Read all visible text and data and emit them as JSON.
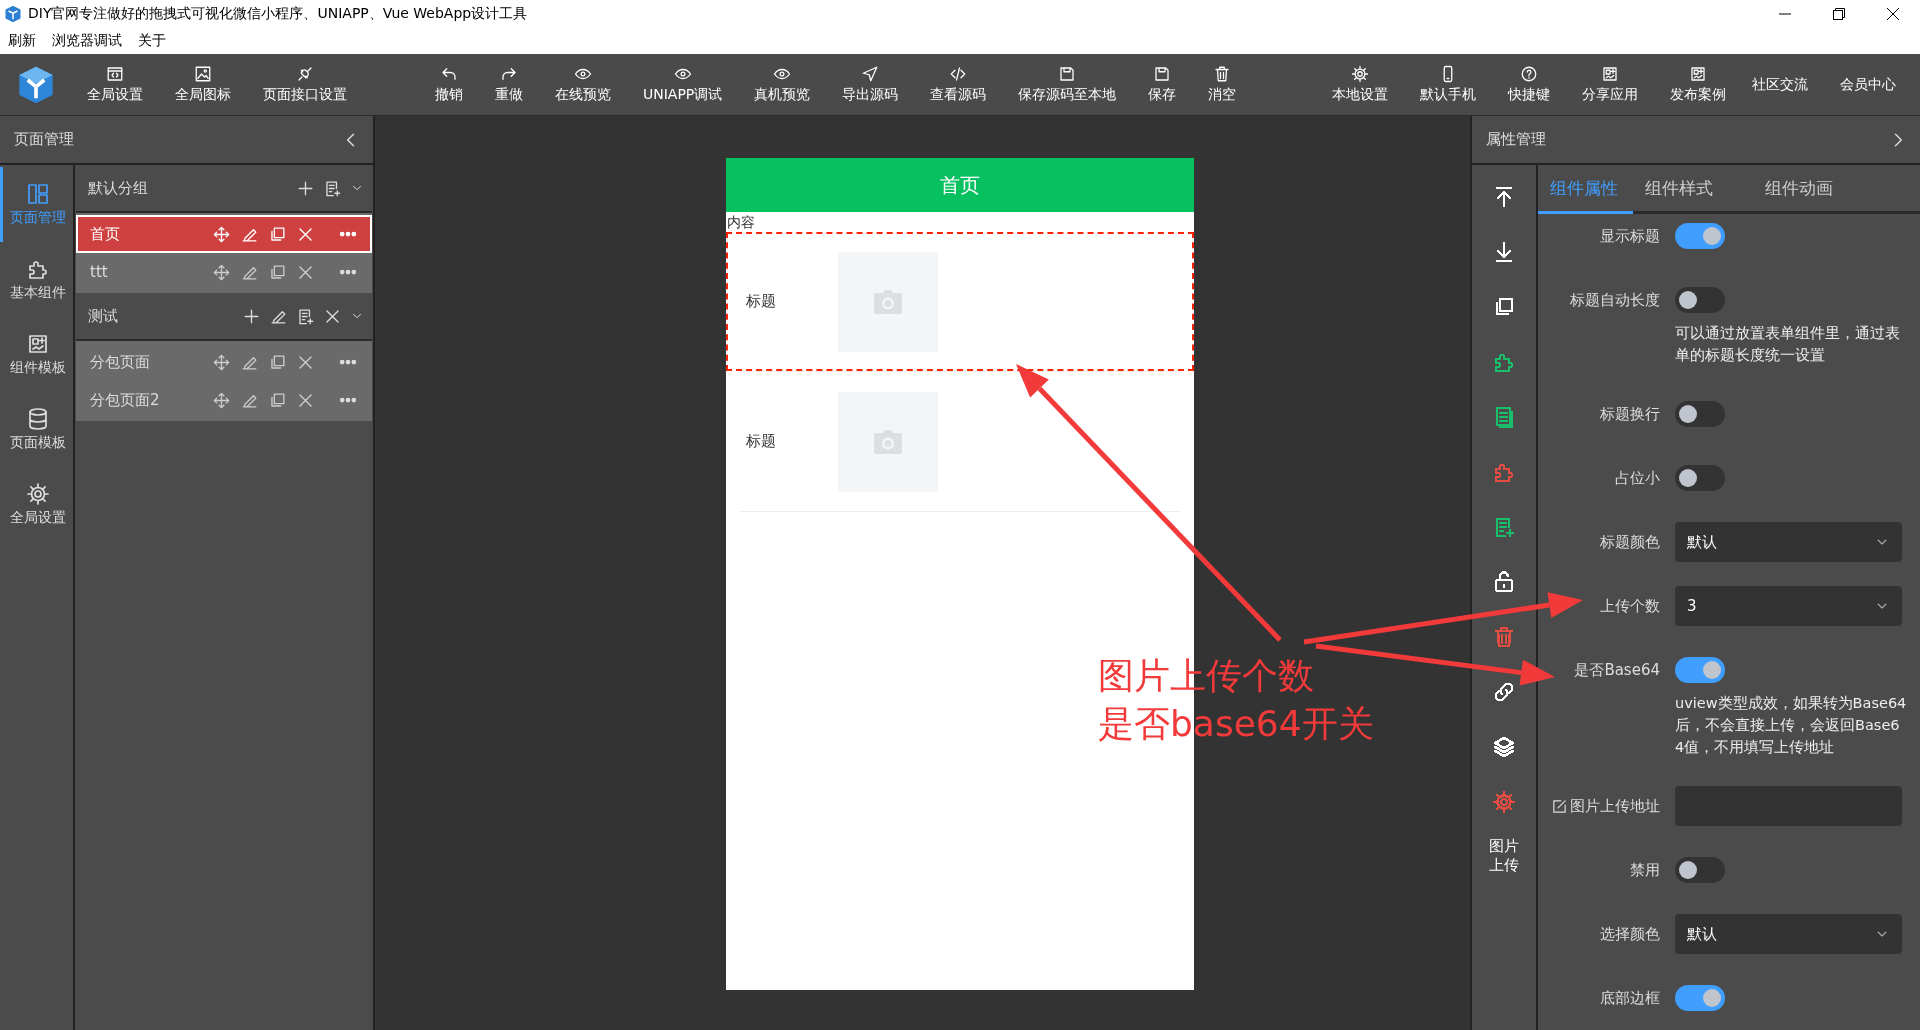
{
  "window": {
    "title": "DIY官网专注做好的拖拽式可视化微信小程序、UNIAPP、Vue WebApp设计工具"
  },
  "menu": [
    "刷新",
    "浏览器调试",
    "关于"
  ],
  "toolbar": {
    "groups": [
      {
        "items": [
          "全局设置",
          "全局图标",
          "页面接口设置"
        ]
      },
      {
        "items": [
          "撤销",
          "重做",
          "在线预览",
          "UNIAPP调试",
          "真机预览",
          "导出源码",
          "查看源码",
          "保存源码至本地",
          "保存",
          "消空"
        ]
      },
      {
        "items": [
          "本地设置",
          "默认手机",
          "快捷键",
          "分享应用",
          "发布案例"
        ]
      },
      {
        "items": [
          "社区交流",
          "会员中心"
        ]
      }
    ]
  },
  "left_panel": {
    "title": "页面管理",
    "nav": [
      {
        "label": "页面管理",
        "selected": true
      },
      {
        "label": "基本组件",
        "selected": false
      },
      {
        "label": "组件模板",
        "selected": false
      },
      {
        "label": "页面模板",
        "selected": false
      },
      {
        "label": "全局设置",
        "selected": false
      }
    ],
    "groups": [
      {
        "name": "默认分组",
        "kind": "default",
        "pages": [
          {
            "name": "首页",
            "selected": true
          },
          {
            "name": "ttt",
            "selected": false
          }
        ]
      },
      {
        "name": "测试",
        "kind": "custom",
        "pages": [
          {
            "name": "分包页面",
            "selected": false
          },
          {
            "name": "分包页面2",
            "selected": false
          }
        ]
      }
    ]
  },
  "phone": {
    "title": "首页",
    "content_label": "内容",
    "items": [
      {
        "label": "标题",
        "selected": true
      },
      {
        "label": "标题",
        "selected": false
      }
    ]
  },
  "right_panel": {
    "title": "属性管理",
    "tools": [
      {
        "color": "#ffffff"
      },
      {
        "color": "#ffffff"
      },
      {
        "color": "#ffffff"
      },
      {
        "color": "#19be6b"
      },
      {
        "color": "#19be6b"
      },
      {
        "color": "#e54d42"
      },
      {
        "color": "#19be6b"
      },
      {
        "color": "#ffffff"
      },
      {
        "color": "#e54d42"
      },
      {
        "color": "#ffffff"
      },
      {
        "color": "#ffffff"
      },
      {
        "color": "#e54d42"
      }
    ],
    "tools_label": "图片上传",
    "tabs": [
      {
        "label": "组件属性",
        "selected": true
      },
      {
        "label": "组件样式",
        "selected": false
      },
      {
        "label": "组件动画",
        "selected": false
      }
    ],
    "fields": [
      {
        "kind": "switch",
        "label": "显示标题",
        "on": true
      },
      {
        "kind": "switch",
        "label": "标题自动长度",
        "on": false,
        "help": "可以通过放置表单组件里，通过表单的标题长度统一设置"
      },
      {
        "kind": "switch",
        "label": "标题换行",
        "on": false
      },
      {
        "kind": "switch",
        "label": "占位小",
        "on": false
      },
      {
        "kind": "select",
        "label": "标题颜色",
        "value": "默认"
      },
      {
        "kind": "select",
        "label": "上传个数",
        "value": "3"
      },
      {
        "kind": "switch",
        "label": "是否Base64",
        "on": true,
        "help": "uview类型成效，如果转为Base64后，不会直接上传，会返回Base64值，不用填写上传地址"
      },
      {
        "kind": "input",
        "label": "图片上传地址"
      },
      {
        "kind": "switch",
        "label": "禁用",
        "on": false
      },
      {
        "kind": "select",
        "label": "选择颜色",
        "value": "默认"
      },
      {
        "kind": "switch",
        "label": "底部边框",
        "on": true
      }
    ]
  },
  "annotation": {
    "lines": [
      "图片上传个数",
      "是否base64开关"
    ]
  }
}
